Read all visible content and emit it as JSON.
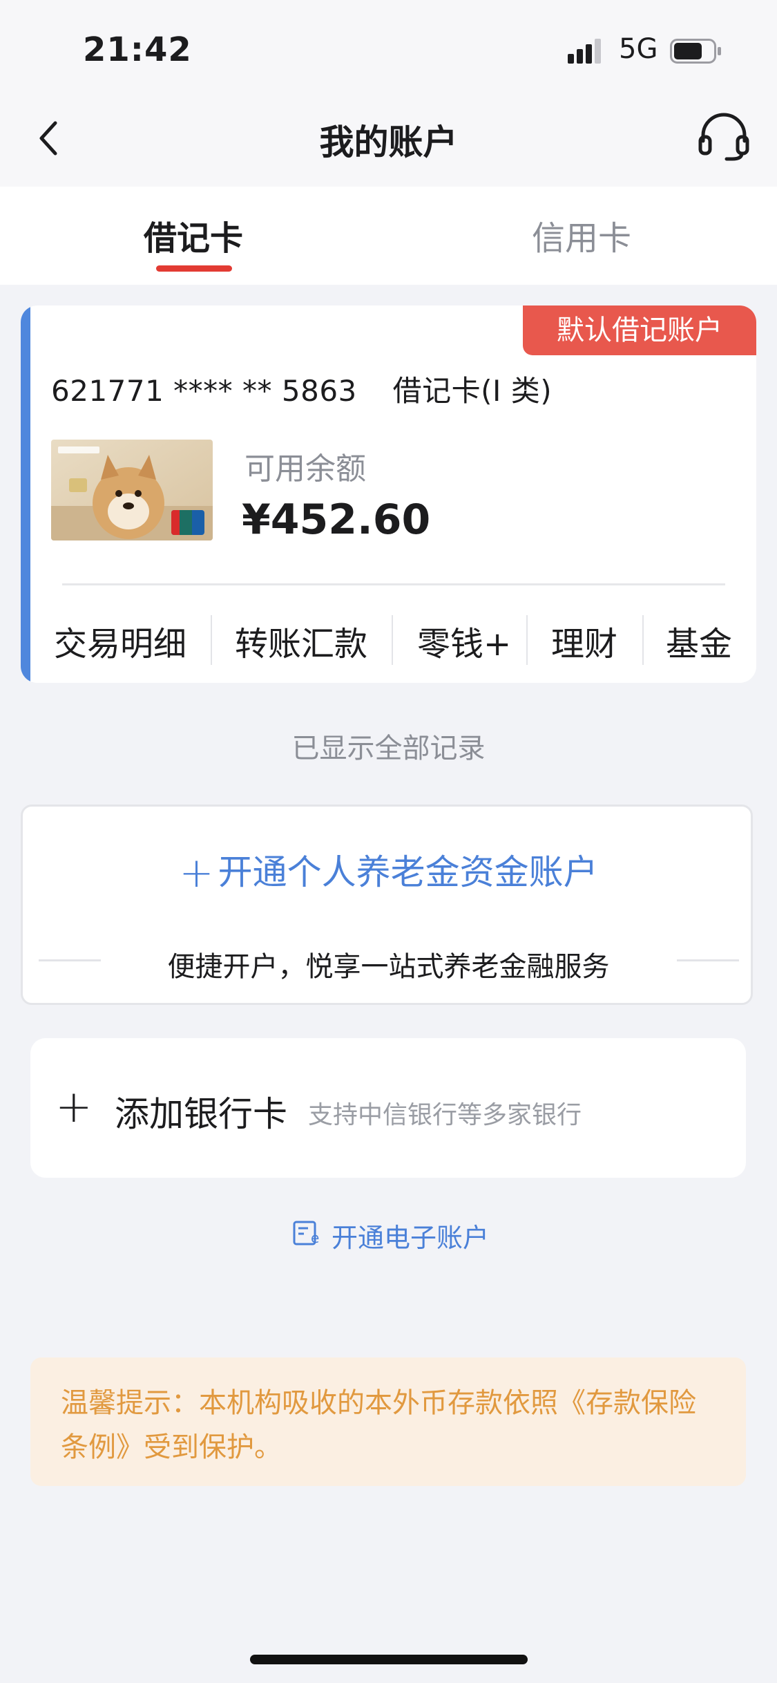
{
  "status_bar": {
    "time": "21:42",
    "network": "5G"
  },
  "nav": {
    "title": "我的账户",
    "back_icon": "chevron-left-icon",
    "service_icon": "headset-icon"
  },
  "tabs": [
    {
      "label": "借记卡",
      "active": true
    },
    {
      "label": "信用卡",
      "active": false
    }
  ],
  "account_card": {
    "badge": "默认借记账户",
    "card_number": "621771 **** ** 5863",
    "card_type": "借记卡(I 类)",
    "balance_label": "可用余额",
    "balance_value": "¥452.60",
    "accent_color": "#4f87dd",
    "actions": [
      "交易明细",
      "转账汇款",
      "零钱+",
      "理财",
      "基金"
    ]
  },
  "all_records_text": "已显示全部记录",
  "pension": {
    "plus": "+",
    "title": "开通个人养老金资金账户",
    "subtitle": "便捷开户，悦享一站式养老金融服务"
  },
  "add_card": {
    "plus": "+",
    "label": "添加银行卡",
    "hint": "支持中信银行等多家银行"
  },
  "e_account": {
    "label": "开通电子账户",
    "icon": "e-account-card-icon"
  },
  "tip": {
    "text": "温馨提示：本机构吸收的本外币存款依照《存款保险条例》受到保护。"
  },
  "colors": {
    "brand_red": "#e23b33",
    "link_blue": "#4a80d8",
    "tip_orange": "#e1993f"
  }
}
